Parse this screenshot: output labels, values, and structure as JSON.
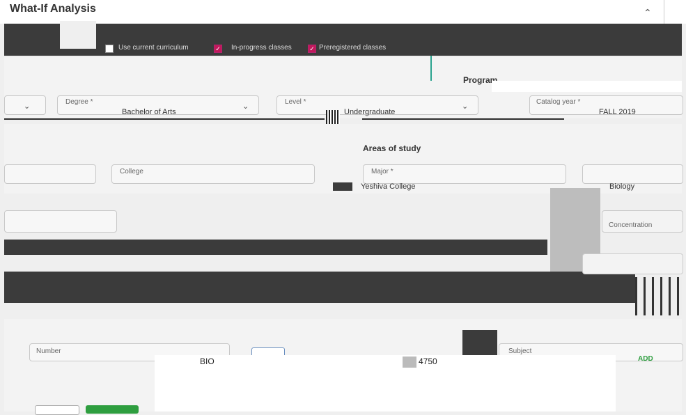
{
  "header": {
    "title": "What-If Analysis",
    "collapse_icon": "chevron-up-icon"
  },
  "options": {
    "use_current_curriculum": "Use current curriculum",
    "in_progress_classes": "In-progress classes",
    "preregistered_classes": "Preregistered classes"
  },
  "program": {
    "title": "Program",
    "degree_label": "Degree *",
    "degree_value": "Bachelor of Arts",
    "level_label": "Level *",
    "level_value": "Undergraduate",
    "catalog_label": "Catalog year *",
    "catalog_value": "FALL 2019"
  },
  "areas": {
    "title": "Areas of study",
    "college_label": "College",
    "major_label": "Major *",
    "major_value": "Yeshiva College",
    "minor_value": "Biology",
    "concentration_label": "Concentration"
  },
  "courses": {
    "number_label": "Number",
    "subject_label": "Subject",
    "subject_value": "BIO",
    "number_value": "4750",
    "add_label": "ADD"
  },
  "colors": {
    "accent": "#c2185b",
    "add_green": "#2e9e3f",
    "dark_bar": "#3b3b3b"
  }
}
